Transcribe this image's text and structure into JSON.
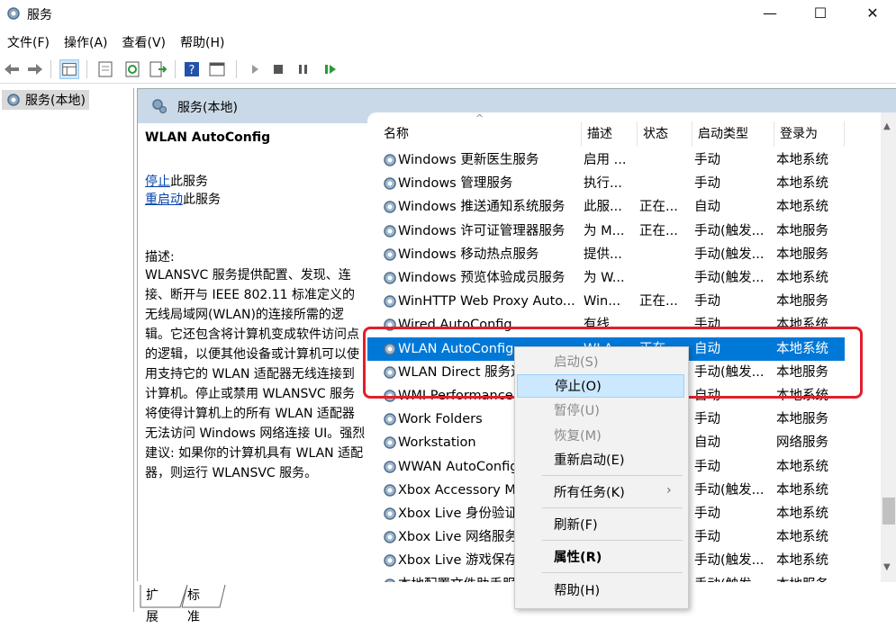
{
  "window": {
    "title": "服务",
    "minimize": "—",
    "maximize": "☐",
    "close": "✕"
  },
  "menu": [
    "文件(F)",
    "操作(A)",
    "查看(V)",
    "帮助(H)"
  ],
  "tree": {
    "root": "服务(本地)"
  },
  "panel": {
    "header": "服务(本地)",
    "service_name": "WLAN AutoConfig",
    "stop_link": "停止",
    "stop_suffix": "此服务",
    "restart_link": "重启动",
    "restart_suffix": "此服务",
    "desc_label": "描述:",
    "description": "WLANSVC 服务提供配置、发现、连接、断开与 IEEE 802.11 标准定义的无线局域网(WLAN)的连接所需的逻辑。它还包含将计算机变成软件访问点的逻辑，以便其他设备或计算机可以使用支持它的 WLAN 适配器无线连接到计算机。停止或禁用 WLANSVC 服务将使得计算机上的所有 WLAN 适配器无法访问 Windows 网络连接 UI。强烈建议: 如果你的计算机具有 WLAN 适配器，则运行 WLANSVC 服务。"
  },
  "columns": [
    "名称",
    "描述",
    "状态",
    "启动类型",
    "登录为"
  ],
  "rows": [
    {
      "name": "Windows 更新医生服务",
      "desc": "启用 ...",
      "status": "",
      "startup": "手动",
      "logon": "本地系统"
    },
    {
      "name": "Windows 管理服务",
      "desc": "执行...",
      "status": "",
      "startup": "手动",
      "logon": "本地系统"
    },
    {
      "name": "Windows 推送通知系统服务",
      "desc": "此服...",
      "status": "正在...",
      "startup": "自动",
      "logon": "本地系统"
    },
    {
      "name": "Windows 许可证管理器服务",
      "desc": "为 M...",
      "status": "正在...",
      "startup": "手动(触发...",
      "logon": "本地服务"
    },
    {
      "name": "Windows 移动热点服务",
      "desc": "提供...",
      "status": "",
      "startup": "手动(触发...",
      "logon": "本地服务"
    },
    {
      "name": "Windows 预览体验成员服务",
      "desc": "为 W...",
      "status": "",
      "startup": "手动(触发...",
      "logon": "本地系统"
    },
    {
      "name": "WinHTTP Web Proxy Auto...",
      "desc": "Win...",
      "status": "正在...",
      "startup": "手动",
      "logon": "本地服务"
    },
    {
      "name": "Wired AutoConfig",
      "desc": "有线...",
      "status": "",
      "startup": "手动",
      "logon": "本地系统"
    },
    {
      "name": "WLAN AutoConfig",
      "desc": "WLA...",
      "status": "正在...",
      "startup": "自动",
      "logon": "本地系统",
      "selected": true
    },
    {
      "name": "WLAN Direct 服务连接管理器",
      "desc": "",
      "status": "",
      "startup": "手动(触发...",
      "logon": "本地服务"
    },
    {
      "name": "WMI Performance Adapter",
      "desc": "",
      "status": "",
      "startup": "自动",
      "logon": "本地系统"
    },
    {
      "name": "Work Folders",
      "desc": "",
      "status": "",
      "startup": "手动",
      "logon": "本地服务"
    },
    {
      "name": "Workstation",
      "desc": "",
      "status": "",
      "startup": "自动",
      "logon": "网络服务"
    },
    {
      "name": "WWAN AutoConfig",
      "desc": "",
      "status": "",
      "startup": "手动",
      "logon": "本地系统"
    },
    {
      "name": "Xbox Accessory Management",
      "desc": "",
      "status": "",
      "startup": "手动(触发...",
      "logon": "本地系统"
    },
    {
      "name": "Xbox Live 身份验证管理器",
      "desc": "",
      "status": "",
      "startup": "手动",
      "logon": "本地系统"
    },
    {
      "name": "Xbox Live 网络服务",
      "desc": "",
      "status": "",
      "startup": "手动",
      "logon": "本地系统"
    },
    {
      "name": "Xbox Live 游戏保存",
      "desc": "",
      "status": "",
      "startup": "手动(触发...",
      "logon": "本地系统"
    },
    {
      "name": "本地配置文件助手服务",
      "desc": "",
      "status": "",
      "startup": "手动(触发...",
      "logon": "本地服务"
    }
  ],
  "tabs": [
    "扩展",
    "标准"
  ],
  "context_menu": {
    "start": "启动(S)",
    "stop": "停止(O)",
    "pause": "暂停(U)",
    "resume": "恢复(M)",
    "restart": "重新启动(E)",
    "all_tasks": "所有任务(K)",
    "refresh": "刷新(F)",
    "properties": "属性(R)",
    "help": "帮助(H)",
    "arrow": "›"
  },
  "colors": {
    "selection": "#0078d7",
    "highlight_box": "#e0202a",
    "panel_header": "#c9d9e8"
  }
}
